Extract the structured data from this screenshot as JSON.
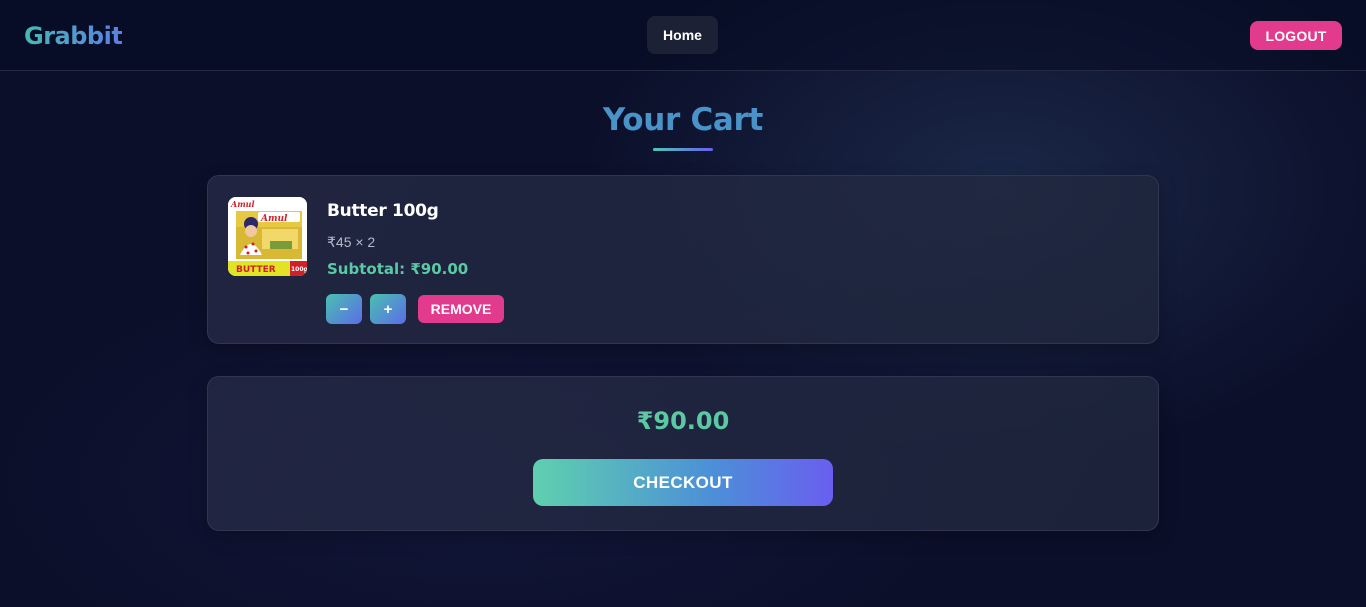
{
  "navbar": {
    "brand": "Grabbit",
    "home_label": "Home",
    "logout_label": "LOGOUT"
  },
  "page": {
    "title": "Your Cart"
  },
  "cart": {
    "items": [
      {
        "name": "Butter 100g",
        "price_qty": "₹45 × 2",
        "subtotal": "Subtotal: ₹90.00",
        "minus_label": "−",
        "plus_label": "+",
        "remove_label": "REMOVE",
        "image": {
          "brand_text": "Amul",
          "product_text": "BUTTER",
          "size_text": "100g"
        }
      }
    ]
  },
  "summary": {
    "total": "₹90.00",
    "checkout_label": "CHECKOUT"
  },
  "colors": {
    "background": "#0b0f2a",
    "accent_pink": "#e23b8d",
    "accent_green": "#5bc9a4",
    "title_blue": "#4a93c8"
  }
}
